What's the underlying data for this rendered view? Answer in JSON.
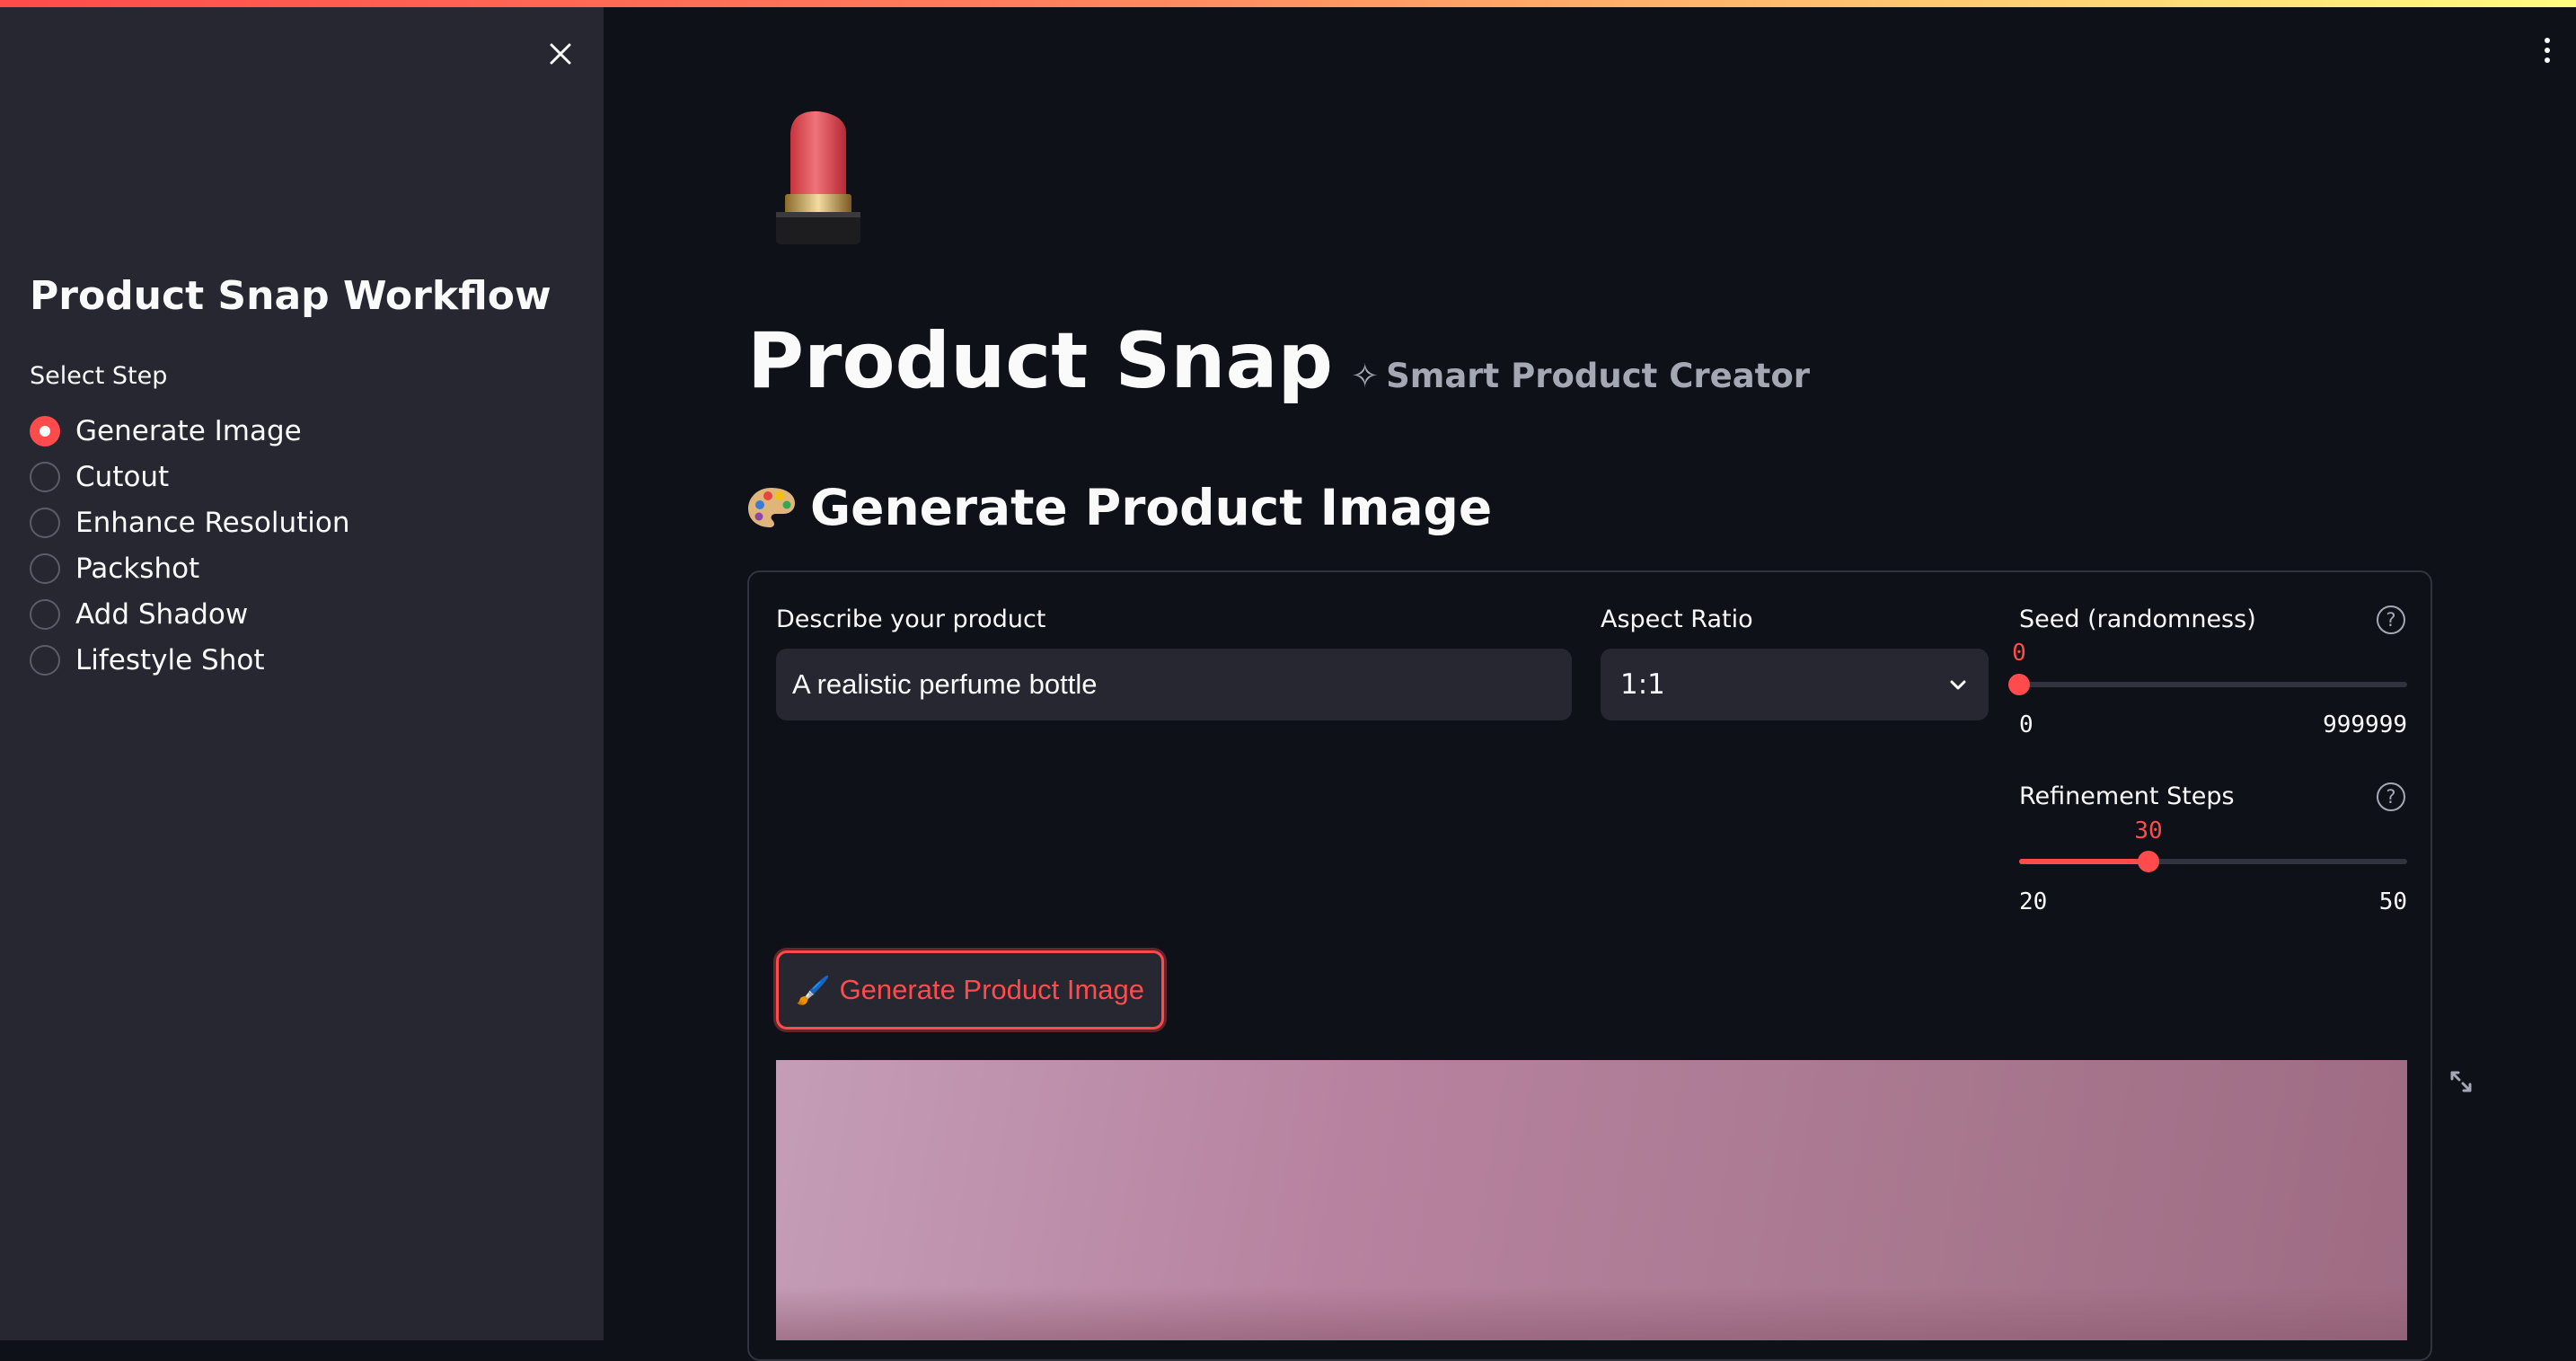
{
  "sidebar": {
    "title": "Product Snap Workflow",
    "select_label": "Select Step",
    "steps": [
      {
        "label": "Generate Image",
        "selected": true
      },
      {
        "label": "Cutout",
        "selected": false
      },
      {
        "label": "Enhance Resolution",
        "selected": false
      },
      {
        "label": "Packshot",
        "selected": false
      },
      {
        "label": "Add Shadow",
        "selected": false
      },
      {
        "label": "Lifestyle Shot",
        "selected": false
      }
    ],
    "close_icon": "close-icon"
  },
  "header": {
    "title": "Product Snap",
    "subtitle_icon": "✧",
    "subtitle": "Smart Product Creator",
    "hero_icon": "lipstick-icon"
  },
  "section": {
    "title": "Generate Product Image",
    "icon": "palette-icon"
  },
  "form": {
    "describe_label": "Describe your product",
    "describe_value": "A realistic perfume bottle",
    "aspect_label": "Aspect Ratio",
    "aspect_value": "1:1",
    "seed": {
      "label": "Seed (randomness)",
      "value": "0",
      "min": "0",
      "max": "999999",
      "fraction": 0
    },
    "steps": {
      "label": "Refinement Steps",
      "value": "30",
      "min": "20",
      "max": "50",
      "fraction": 0.3333
    },
    "help_glyph": "?",
    "button_label": "Generate Product Image",
    "button_icon": "🖌️"
  },
  "colors": {
    "accent": "#ff4b4b",
    "background": "#0e1117",
    "sidebar": "#262730"
  }
}
